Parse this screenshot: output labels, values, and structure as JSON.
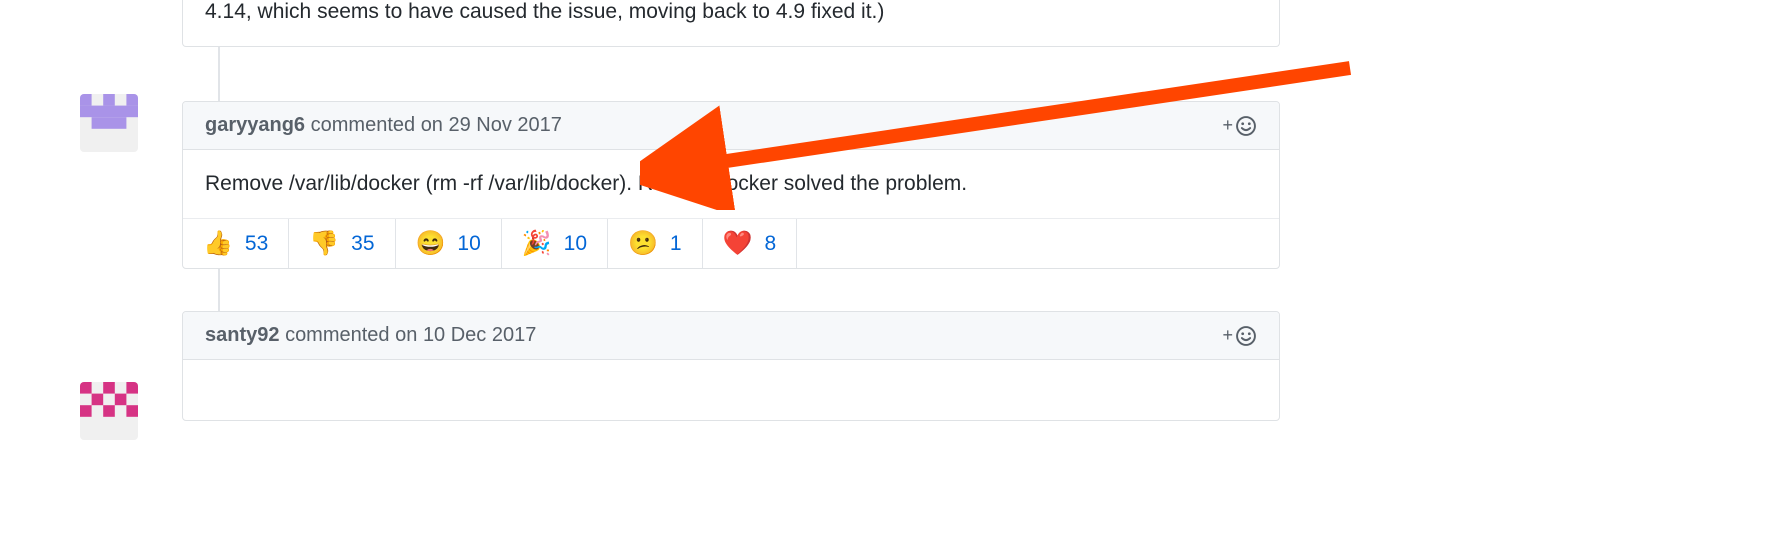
{
  "prev_comment": {
    "body_fragment": "4.14, which seems to have caused the issue, moving back to 4.9 fixed it.)"
  },
  "comment1": {
    "author": "garyyang6",
    "verb": "commented",
    "date_prefix": "on",
    "date": "29 Nov 2017",
    "body": "Remove /var/lib/docker (rm -rf /var/lib/docker). Restart Docker solved the problem.",
    "add_symbol": "+",
    "reactions": [
      {
        "emoji": "👍",
        "count": 53
      },
      {
        "emoji": "👎",
        "count": 35
      },
      {
        "emoji": "😄",
        "count": 10
      },
      {
        "emoji": "🎉",
        "count": 10
      },
      {
        "emoji": "😕",
        "count": 1
      },
      {
        "emoji": "❤️",
        "count": 8
      }
    ]
  },
  "comment2": {
    "author": "santy92",
    "verb": "commented",
    "date_prefix": "on",
    "date": "10 Dec 2017",
    "add_symbol": "+"
  }
}
